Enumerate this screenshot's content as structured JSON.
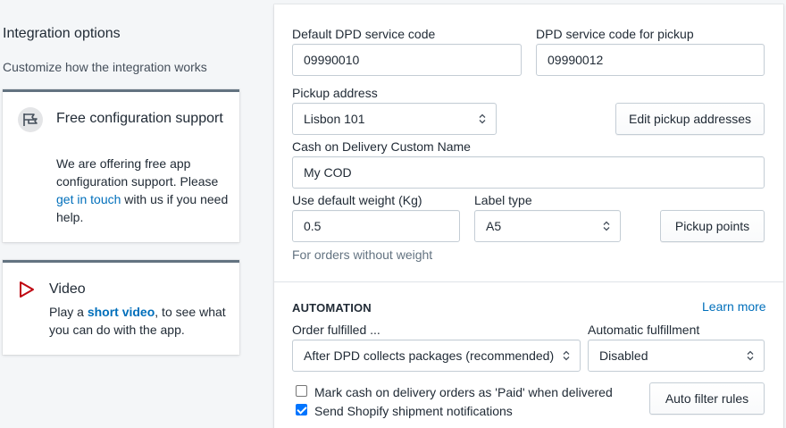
{
  "left": {
    "title": "Integration options",
    "description": "Customize how the integration works",
    "support_card": {
      "icon": "conversation-icon",
      "title": "Free configuration support",
      "text_before": "We are offering free app configuration support. Please ",
      "link": "get in touch",
      "text_after": " with us if you need help."
    },
    "video_card": {
      "icon": "play-icon",
      "title": "Video",
      "text_before": "Play a ",
      "link": "short video",
      "text_after": ", to see what you can do with the app."
    }
  },
  "settings": {
    "service_code_label": "Default DPD service code",
    "service_code_value": "09990010",
    "pickup_code_label": "DPD service code for pickup",
    "pickup_code_value": "09990012",
    "pickup_address_label": "Pickup address",
    "pickup_address_value": "Lisbon 101",
    "edit_pickup_button": "Edit pickup addresses",
    "cod_label": "Cash on Delivery Custom Name",
    "cod_value": "My COD",
    "weight_label": "Use default weight (Kg)",
    "weight_value": "0.5",
    "weight_hint": "For orders without weight",
    "label_type_label": "Label type",
    "label_type_value": "A5",
    "pickup_points_button": "Pickup points"
  },
  "automation": {
    "heading": "AUTOMATION",
    "learn_more": "Learn more",
    "order_fulfilled_label": "Order fulfilled ...",
    "order_fulfilled_value": "After DPD collects packages (recommended)",
    "auto_fulfillment_label": "Automatic fulfillment",
    "auto_fulfillment_value": "Disabled",
    "mark_paid_label": "Mark cash on delivery orders as 'Paid' when delivered",
    "mark_paid_checked": false,
    "send_notifications_label": "Send Shopify shipment notifications",
    "send_notifications_checked": true,
    "auto_filter_button": "Auto filter rules"
  },
  "colors": {
    "link": "#006fbb",
    "checkbox_checked": "#0075ff",
    "play_icon": "#bf0711"
  }
}
